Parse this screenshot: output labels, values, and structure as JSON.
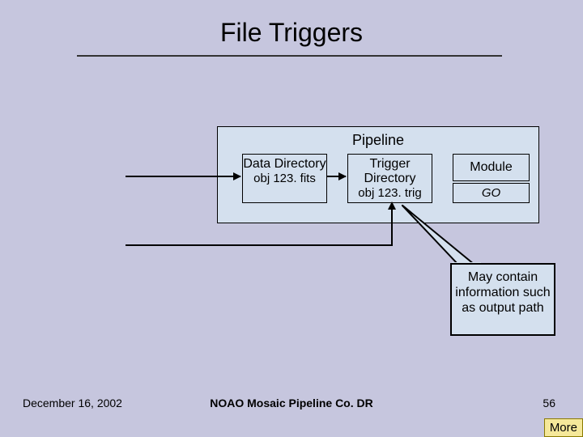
{
  "title": "File Triggers",
  "pipeline": {
    "label": "Pipeline",
    "box1_head": "Data Directory",
    "box1_sub": "obj 123. fits",
    "box2_head": "Trigger Directory",
    "box2_sub": "obj 123. trig",
    "box3_head": "Module",
    "box4_sub": "GO"
  },
  "callout": "May contain information such as output path",
  "footer": {
    "date": "December 16, 2002",
    "center": "NOAO Mosaic Pipeline Co. DR",
    "page": "56",
    "more": "More"
  }
}
